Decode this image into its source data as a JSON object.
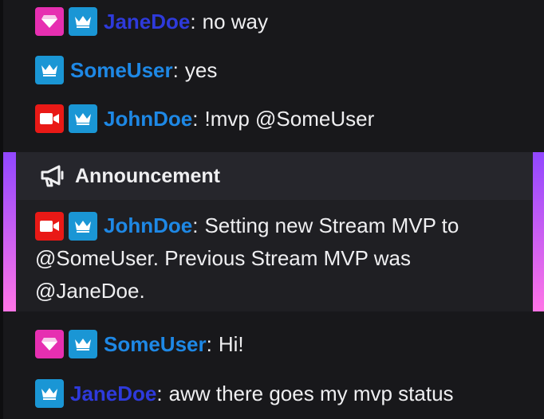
{
  "colors": {
    "background": "#18181b",
    "announcement_bg": "#1f1f23",
    "announcement_header_bg": "#26262c",
    "announcement_gradient_top": "#9147ff",
    "announcement_gradient_bottom": "#ff75e6",
    "text": "#efeff1",
    "janedoe": "#2e3adb",
    "someuser": "#1e88e5",
    "johndoe": "#1e88e5",
    "badge_pink": "#e62fb1",
    "badge_red": "#e91916",
    "badge_blue": "#1a96d5"
  },
  "chat": {
    "messages": [
      {
        "username": "JaneDoe",
        "separator": ":",
        "text": "no way",
        "badges": [
          "gem-icon",
          "crown-icon"
        ]
      },
      {
        "username": "SomeUser",
        "separator": ":",
        "text": "yes",
        "badges": [
          "crown-icon"
        ]
      },
      {
        "username": "JohnDoe",
        "separator": ":",
        "text": "!mvp @SomeUser",
        "badges": [
          "camera-icon",
          "crown-icon"
        ]
      },
      {
        "username": "SomeUser",
        "separator": ":",
        "text": "Hi!",
        "badges": [
          "gem-icon",
          "crown-icon"
        ]
      },
      {
        "username": "JaneDoe",
        "separator": ":",
        "text": "aww there goes my mvp status",
        "badges": [
          "crown-icon"
        ]
      }
    ],
    "announcement": {
      "label": "Announcement",
      "icon": "megaphone-icon",
      "username": "JohnDoe",
      "separator": ":",
      "text_line1": "Setting new Stream MVP to",
      "text_line2": "@SomeUser. Previous Stream MVP was",
      "text_line3": "@JaneDoe.",
      "badges": [
        "camera-icon",
        "crown-icon"
      ]
    }
  }
}
